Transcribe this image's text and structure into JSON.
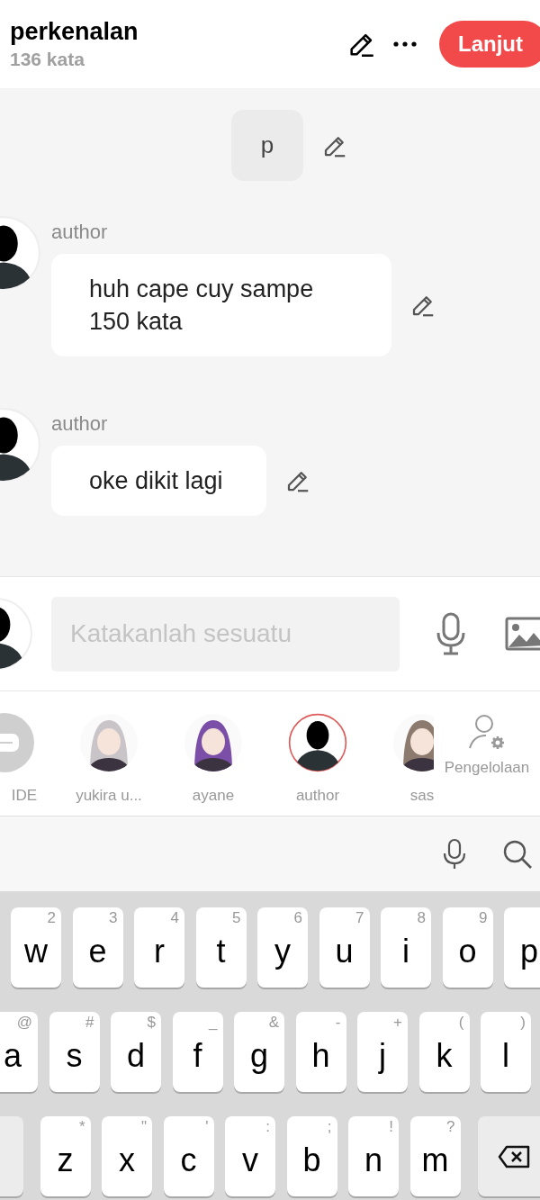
{
  "header": {
    "title": "perkenalan",
    "word_count": "136 kata",
    "next_button": "Lanjut"
  },
  "messages": [
    {
      "kind": "self",
      "text": "p"
    },
    {
      "kind": "author",
      "name": "author",
      "text": "huh cape cuy sampe 150 kata"
    },
    {
      "kind": "author",
      "name": "author",
      "text": "oke dikit lagi"
    }
  ],
  "composer": {
    "placeholder": "Katakanlah sesuatu"
  },
  "characters": [
    {
      "kind": "narrator",
      "name": "IDE",
      "selected": false
    },
    {
      "kind": "picture",
      "name": "yukira u...",
      "selected": false
    },
    {
      "kind": "picture",
      "name": "ayane",
      "selected": false
    },
    {
      "kind": "silhouette",
      "name": "author",
      "selected": true
    },
    {
      "kind": "picture",
      "name": "sas",
      "selected": false
    }
  ],
  "manage_label": "Pengelolaan",
  "keyboard": {
    "rows": [
      [
        {
          "label": "w",
          "hint": "2"
        },
        {
          "label": "e",
          "hint": "3"
        },
        {
          "label": "r",
          "hint": "4"
        },
        {
          "label": "t",
          "hint": "5"
        },
        {
          "label": "y",
          "hint": "6"
        },
        {
          "label": "u",
          "hint": "7"
        },
        {
          "label": "i",
          "hint": "8"
        },
        {
          "label": "o",
          "hint": "9"
        },
        {
          "label": "p"
        }
      ],
      [
        {
          "label": "a",
          "hint": "@"
        },
        {
          "label": "s",
          "hint": "#"
        },
        {
          "label": "d",
          "hint": "$"
        },
        {
          "label": "f",
          "hint": "_"
        },
        {
          "label": "g",
          "hint": "&"
        },
        {
          "label": "h",
          "hint": "-"
        },
        {
          "label": "j",
          "hint": "+"
        },
        {
          "label": "k",
          "hint": "("
        },
        {
          "label": "l",
          "hint": ")"
        }
      ],
      [
        {
          "kind": "shift"
        },
        {
          "label": "z",
          "hint": "*"
        },
        {
          "label": "x",
          "hint": "\""
        },
        {
          "label": "c",
          "hint": "'"
        },
        {
          "label": "v",
          "hint": ":"
        },
        {
          "label": "b",
          "hint": ";"
        },
        {
          "label": "n",
          "hint": "!"
        },
        {
          "label": "m",
          "hint": "?"
        },
        {
          "kind": "backspace"
        }
      ]
    ]
  }
}
